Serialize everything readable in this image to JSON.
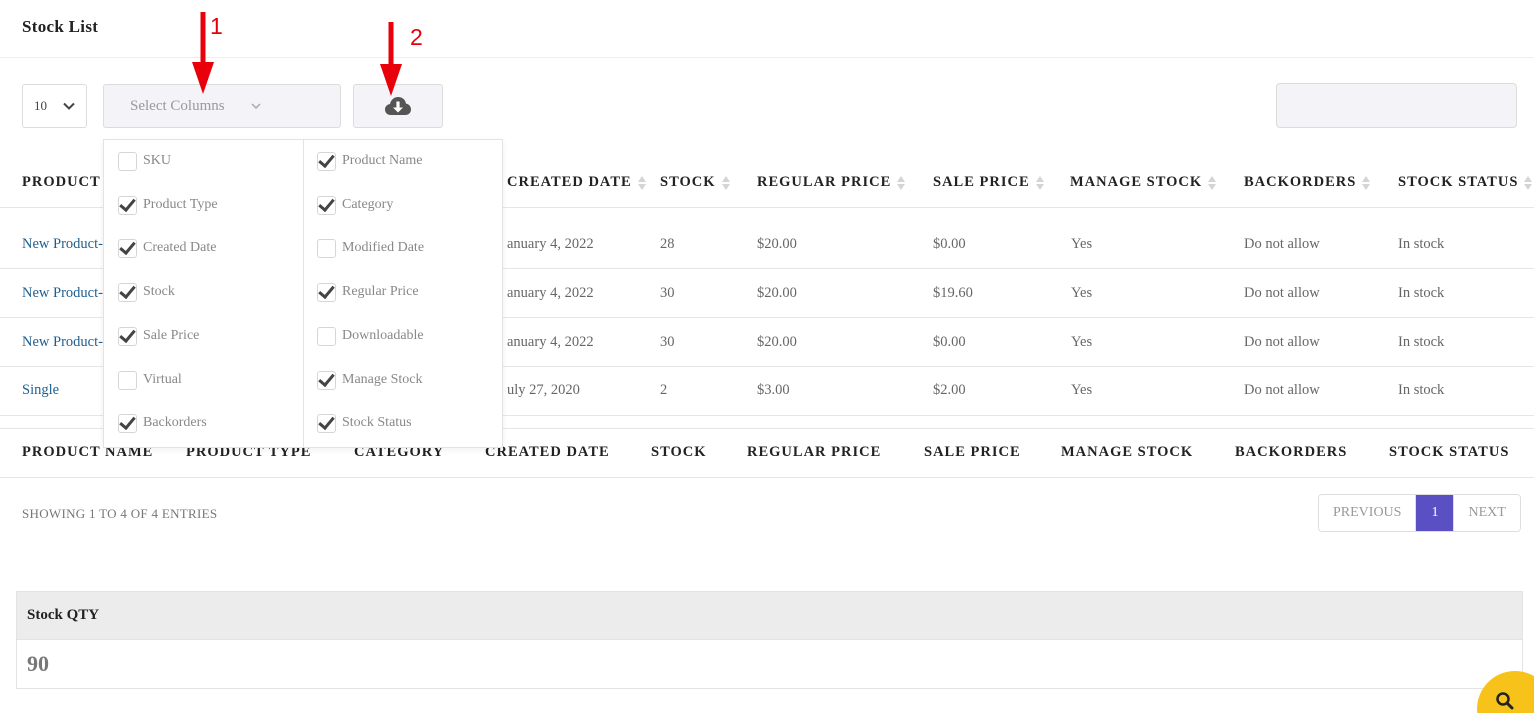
{
  "page": {
    "title": "Stock List"
  },
  "controls": {
    "length_value": "10",
    "select_columns_placeholder": "Select Columns",
    "search_value": ""
  },
  "annotations": {
    "arrow1": "1",
    "arrow2": "2"
  },
  "column_options": [
    {
      "label": "SKU",
      "checked": false
    },
    {
      "label": "Product Name",
      "checked": true
    },
    {
      "label": "Product Type",
      "checked": true
    },
    {
      "label": "Category",
      "checked": true
    },
    {
      "label": "Created Date",
      "checked": true
    },
    {
      "label": "Modified Date",
      "checked": false
    },
    {
      "label": "Stock",
      "checked": true
    },
    {
      "label": "Regular Price",
      "checked": true
    },
    {
      "label": "Sale Price",
      "checked": true
    },
    {
      "label": "Downloadable",
      "checked": false
    },
    {
      "label": "Virtual",
      "checked": false
    },
    {
      "label": "Manage Stock",
      "checked": true
    },
    {
      "label": "Backorders",
      "checked": true
    },
    {
      "label": "Stock Status",
      "checked": true
    }
  ],
  "table": {
    "headers": {
      "product": "PRODUCT",
      "created_date": "CREATED DATE",
      "stock": "STOCK",
      "regular_price": "REGULAR PRICE",
      "sale_price": "SALE PRICE",
      "manage_stock": "MANAGE STOCK",
      "backorders": "BACKORDERS",
      "stock_status": "STOCK STATUS"
    },
    "rows": [
      {
        "name": "New Product-",
        "created": "anuary 4, 2022",
        "stock": "28",
        "regular": "$20.00",
        "sale": "$0.00",
        "manage": "Yes",
        "backorders": "Do not allow",
        "status": "In stock"
      },
      {
        "name": "New Product-",
        "created": "anuary 4, 2022",
        "stock": "30",
        "regular": "$20.00",
        "sale": "$19.60",
        "manage": "Yes",
        "backorders": "Do not allow",
        "status": "In stock"
      },
      {
        "name": "New Product-",
        "created": "anuary 4, 2022",
        "stock": "30",
        "regular": "$20.00",
        "sale": "$0.00",
        "manage": "Yes",
        "backorders": "Do not allow",
        "status": "In stock"
      },
      {
        "name": "Single",
        "created": "uly 27, 2020",
        "stock": "2",
        "regular": "$3.00",
        "sale": "$2.00",
        "manage": "Yes",
        "backorders": "Do not allow",
        "status": "In stock"
      }
    ],
    "footer": {
      "product_name": "PRODUCT NAME",
      "product_type": "PRODUCT TYPE",
      "category": "CATEGORY",
      "created_date": "CREATED DATE",
      "stock": "STOCK",
      "regular_price": "REGULAR PRICE",
      "sale_price": "SALE PRICE",
      "manage_stock": "MANAGE STOCK",
      "backorders": "BACKORDERS",
      "stock_status": "STOCK STATUS"
    }
  },
  "info": "SHOWING 1 TO 4 OF 4 ENTRIES",
  "pagination": {
    "previous": "PREVIOUS",
    "current": "1",
    "next": "NEXT"
  },
  "stock_qty": {
    "label": "Stock QTY",
    "value": "90"
  },
  "colors": {
    "accent": "#5b4fc4",
    "fab": "#f7c31b",
    "link": "#1e5f8f",
    "annotation": "#e8000b"
  },
  "icons": {
    "download": "cloud-download-icon",
    "search": "search-icon",
    "chevron": "chevron-down-icon"
  }
}
